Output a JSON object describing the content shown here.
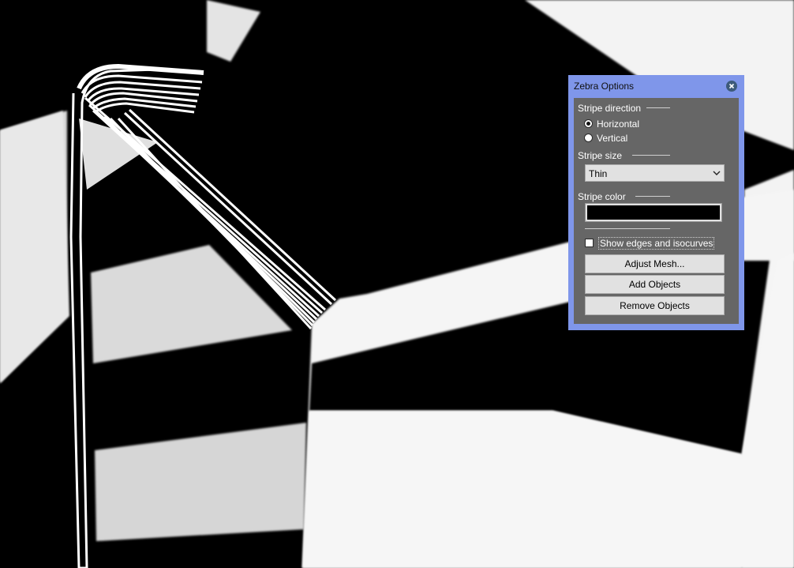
{
  "viewport": {
    "description_colors": {
      "background": "#000000",
      "stripe_light": "#d6d6d6",
      "stripe_white": "#f2f2f2"
    }
  },
  "zebra_panel": {
    "title": "Zebra Options",
    "close_icon": "close-icon",
    "accent_color": "#7f96ea",
    "body_color": "#666666",
    "stripe_direction": {
      "label": "Stripe direction",
      "options": [
        {
          "label": "Horizontal",
          "selected": true
        },
        {
          "label": "Vertical",
          "selected": false
        }
      ]
    },
    "stripe_size": {
      "label": "Stripe size",
      "selected": "Thin"
    },
    "stripe_color": {
      "label": "Stripe color",
      "value": "#000000"
    },
    "show_edges": {
      "label": "Show edges and isocurves",
      "checked": false
    },
    "buttons": {
      "adjust_mesh": "Adjust Mesh...",
      "add_objects": "Add Objects",
      "remove_objects": "Remove Objects"
    }
  }
}
